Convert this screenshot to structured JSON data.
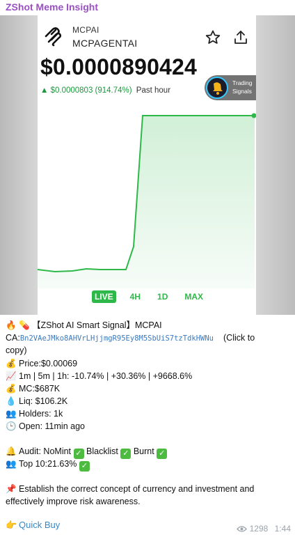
{
  "channel": {
    "name": "ZShot Meme Insight"
  },
  "card": {
    "symbol": "MCPAI",
    "name": "MCPAGENTAI",
    "price": "$0.0000890424",
    "change": "▲ $0.0000803 (914.74%)",
    "period": "Past hour",
    "badge_line1": "Trading",
    "badge_line2": "Signals",
    "timeframes": [
      "LIVE",
      "4H",
      "1D",
      "MAX"
    ],
    "active_timeframe": "LIVE",
    "accent": "#2fb84a"
  },
  "message": {
    "title": "【ZShot AI Smart Signal】MCPAI",
    "ca_label": "CA:",
    "ca": "Bn2VAeJMko8AHVrLHjjmgR95Ey8M5SbUiS7tzTdkHWNu",
    "ca_hint": "(Click to",
    "ca_hint2": "copy)",
    "price": "Price:$0.00069",
    "changes": "1m | 5m | 1h: -10.74% | +30.36% | +9668.6%",
    "mc": "MC:$687K",
    "liq": "Liq: $106.2K",
    "holders": "Holders: 1k",
    "open": "Open: 11min  ago",
    "audit_label": "Audit: NoMint",
    "blacklist_label": "Blacklist",
    "burnt_label": "Burnt",
    "top10": "Top 10:21.63%",
    "advice_line1": "Establish the correct concept of currency and investment and",
    "advice_line2": "effectively improve risk awareness.",
    "quick_buy": "Quick Buy"
  },
  "footer": {
    "views": "1298",
    "time": "1:44"
  },
  "icons": {
    "fire": "🔥",
    "pill": "💊",
    "money_bag": "💰",
    "chart_up": "📈",
    "droplet": "💧",
    "people": "👥",
    "clock": "🕒",
    "bell": "🔔",
    "pin": "📌",
    "point": "👉",
    "check": "✓"
  }
}
